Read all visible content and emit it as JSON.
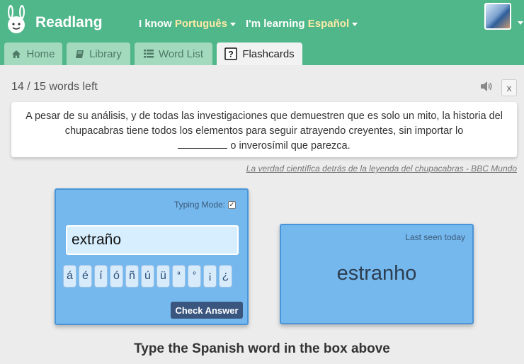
{
  "header": {
    "brand": "Readlang",
    "know_prefix": "I know",
    "know_language": "Português",
    "learning_prefix": "I'm learning",
    "learning_language": "Español",
    "brand_color": "#4fb78a"
  },
  "tabs": [
    {
      "label": "Home",
      "icon": "home-icon",
      "active": false
    },
    {
      "label": "Library",
      "icon": "book-icon",
      "active": false
    },
    {
      "label": "Word List",
      "icon": "list-icon",
      "active": false
    },
    {
      "label": "Flashcards",
      "icon": "question-icon",
      "active": true
    }
  ],
  "progress": {
    "text": "14 / 15 words left",
    "close_label": "x"
  },
  "sentence": {
    "before": "A pesar de su análisis, y de todas las investigaciones que demuestren que es solo un mito, la historia del chupacabras tiene todos los elementos para seguir atrayendo creyentes, sin importar lo",
    "after": "o inverosímil que parezca.",
    "source": "La verdad científica detrás de la leyenda del chupacabras - BBC Mundo"
  },
  "answer_card": {
    "typing_mode_label": "Typing Mode:",
    "typing_mode_checked": true,
    "input_value": "extraño",
    "accents": [
      "á",
      "é",
      "í",
      "ó",
      "ñ",
      "ú",
      "ü",
      "ª",
      "º",
      "¡",
      "¿"
    ],
    "check_button": "Check Answer"
  },
  "prompt_card": {
    "last_seen": "Last seen today",
    "word": "estranho"
  },
  "instruction": "Type the Spanish word in the box above"
}
